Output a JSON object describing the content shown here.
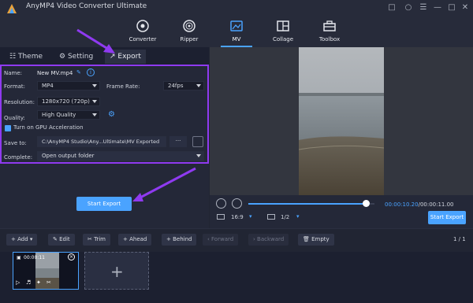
{
  "app": {
    "title": "AnyMP4 Video Converter Ultimate"
  },
  "nav": {
    "items": [
      {
        "label": "Converter",
        "icon": "converter-icon"
      },
      {
        "label": "Ripper",
        "icon": "ripper-icon"
      },
      {
        "label": "MV",
        "icon": "mv-icon"
      },
      {
        "label": "Collage",
        "icon": "collage-icon"
      },
      {
        "label": "Toolbox",
        "icon": "toolbox-icon"
      }
    ],
    "active": "MV"
  },
  "tabs": {
    "theme": "Theme",
    "setting": "Setting",
    "export": "Export"
  },
  "form": {
    "name_label": "Name:",
    "name_value": "New MV.mp4",
    "format_label": "Format:",
    "format_value": "MP4",
    "framerate_label": "Frame Rate:",
    "framerate_value": "24fps",
    "resolution_label": "Resolution:",
    "resolution_value": "1280x720 (720p)",
    "quality_label": "Quality:",
    "quality_value": "High Quality",
    "gpu_label": "Turn on GPU Acceleration",
    "gpu_checked": true,
    "saveto_label": "Save to:",
    "saveto_value": "C:\\AnyMP4 Studio\\Any...Ultimate\\MV Exported",
    "browse": "···",
    "complete_label": "Complete:",
    "complete_value": "Open output folder"
  },
  "buttons": {
    "start_export": "Start Export",
    "start_export_small": "Start Export"
  },
  "player": {
    "current_time": "00:00:10.20",
    "separator": "/",
    "total_time": "00:00:11.00",
    "progress": 0.93,
    "aspect": "16:9",
    "page": "1/2"
  },
  "toolbar": {
    "add": "Add",
    "edit": "Edit",
    "trim": "Trim",
    "ahead": "Ahead",
    "behind": "Behind",
    "forward": "Forward",
    "backward": "Backward",
    "empty": "Empty",
    "page": "1 / 1"
  },
  "clip": {
    "duration": "00:00:11"
  },
  "colors": {
    "accent": "#4aa3ff",
    "highlight": "#8f3af0"
  }
}
